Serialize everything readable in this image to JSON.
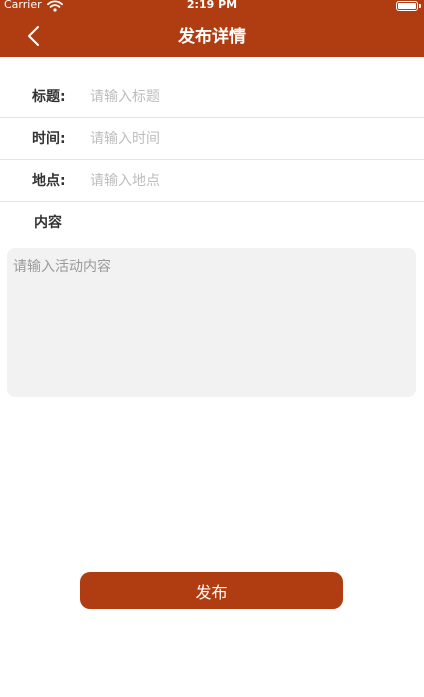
{
  "status_bar": {
    "carrier": "Carrier",
    "time": "2:19 PM"
  },
  "nav": {
    "title": "发布详情",
    "back_icon": "chevron-left-icon"
  },
  "form": {
    "title": {
      "label": "标题:",
      "placeholder": "请输入标题",
      "value": ""
    },
    "time": {
      "label": "时间:",
      "placeholder": "请输入时间",
      "value": ""
    },
    "location": {
      "label": "地点:",
      "placeholder": "请输入地点",
      "value": ""
    },
    "content": {
      "label": "内容",
      "placeholder": "请输入活动内容",
      "value": ""
    }
  },
  "actions": {
    "publish_label": "发布"
  },
  "colors": {
    "brand": "#b03d12",
    "input_bg": "#f2f2f2",
    "placeholder": "#bdbdbd",
    "divider": "#e4e4e4"
  }
}
